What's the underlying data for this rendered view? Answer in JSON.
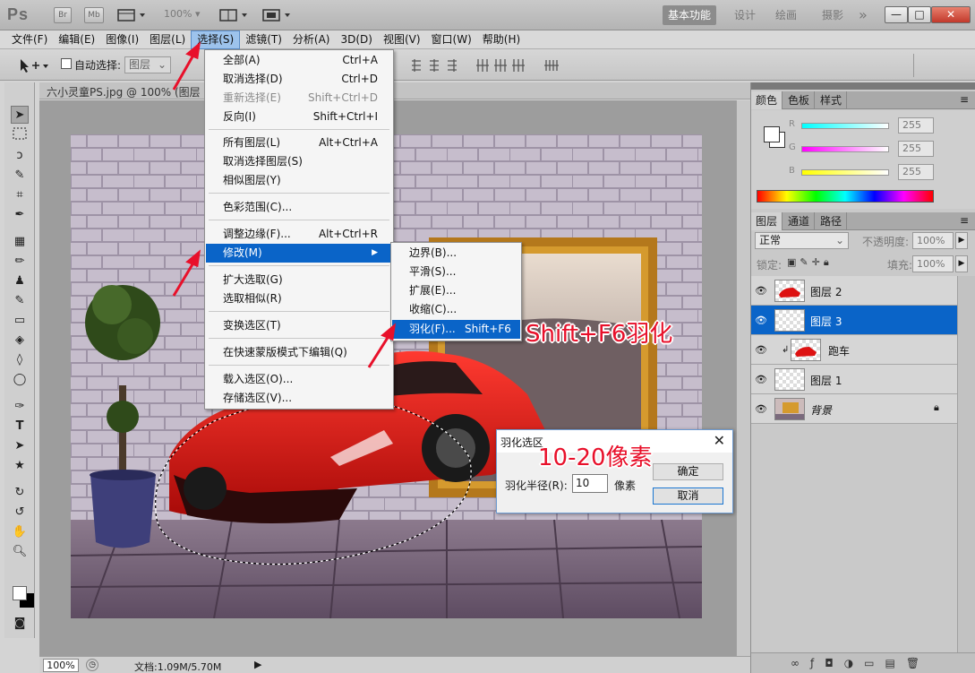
{
  "app": {
    "logo": "Ps",
    "buttons": [
      "Br",
      "Mb"
    ],
    "zoom_preset": "100%",
    "workspaces": [
      "基本功能",
      "设计",
      "绘画",
      "摄影"
    ],
    "more": "»",
    "window_controls": [
      "—",
      "□",
      "✕"
    ]
  },
  "menubar": [
    "文件(F)",
    "编辑(E)",
    "图像(I)",
    "图层(L)",
    "选择(S)",
    "滤镜(T)",
    "分析(A)",
    "3D(D)",
    "视图(V)",
    "窗口(W)",
    "帮助(H)"
  ],
  "options": {
    "auto_select_label": "自动选择:",
    "auto_select_value": "图层"
  },
  "document": {
    "tab_title": "六小灵童PS.jpg @ 100% (图层 3",
    "zoom": "100%",
    "doc_info": "文档:1.09M/5.70M"
  },
  "select_menu": [
    {
      "label": "全部(A)",
      "shortcut": "Ctrl+A",
      "state": "normal"
    },
    {
      "label": "取消选择(D)",
      "shortcut": "Ctrl+D",
      "state": "normal"
    },
    {
      "label": "重新选择(E)",
      "shortcut": "Shift+Ctrl+D",
      "state": "disabled"
    },
    {
      "label": "反向(I)",
      "shortcut": "Shift+Ctrl+I",
      "state": "normal"
    },
    {
      "label": "所有图层(L)",
      "shortcut": "Alt+Ctrl+A",
      "state": "normal"
    },
    {
      "label": "取消选择图层(S)",
      "shortcut": "",
      "state": "normal"
    },
    {
      "label": "相似图层(Y)",
      "shortcut": "",
      "state": "normal"
    },
    {
      "label": "色彩范围(C)...",
      "shortcut": "",
      "state": "normal"
    },
    {
      "label": "调整边缘(F)...",
      "shortcut": "Alt+Ctrl+R",
      "state": "normal"
    },
    {
      "label": "修改(M)",
      "shortcut": "",
      "state": "highlighted",
      "submenu": true
    },
    {
      "label": "扩大选取(G)",
      "shortcut": "",
      "state": "normal"
    },
    {
      "label": "选取相似(R)",
      "shortcut": "",
      "state": "normal"
    },
    {
      "label": "变换选区(T)",
      "shortcut": "",
      "state": "normal"
    },
    {
      "label": "在快速蒙版模式下编辑(Q)",
      "shortcut": "",
      "state": "normal"
    },
    {
      "label": "载入选区(O)...",
      "shortcut": "",
      "state": "normal"
    },
    {
      "label": "存储选区(V)...",
      "shortcut": "",
      "state": "normal"
    }
  ],
  "modify_submenu": [
    {
      "label": "边界(B)...",
      "shortcut": "",
      "state": "normal"
    },
    {
      "label": "平滑(S)...",
      "shortcut": "",
      "state": "normal"
    },
    {
      "label": "扩展(E)...",
      "shortcut": "",
      "state": "normal"
    },
    {
      "label": "收缩(C)...",
      "shortcut": "",
      "state": "normal"
    },
    {
      "label": "羽化(F)...",
      "shortcut": "Shift+F6",
      "state": "highlighted"
    }
  ],
  "annotations": {
    "shortcut_note": "Shift+F6羽化",
    "pixels_note": "10-20像素"
  },
  "feather_dialog": {
    "title": "羽化选区",
    "radius_label": "羽化半径(R):",
    "radius_value": "10",
    "unit": "像素",
    "ok": "确定",
    "cancel": "取消"
  },
  "color_panel": {
    "tabs": [
      "颜色",
      "色板",
      "样式"
    ],
    "channels": [
      {
        "label": "R",
        "value": "255",
        "gradient": [
          "#ffffff",
          "#00ffff"
        ]
      },
      {
        "label": "G",
        "value": "255",
        "gradient": [
          "#ffffff",
          "#ff00ff"
        ]
      },
      {
        "label": "B",
        "value": "255",
        "gradient": [
          "#ffffff",
          "#ffff00"
        ]
      }
    ]
  },
  "layers_panel": {
    "tabs": [
      "图层",
      "通道",
      "路径"
    ],
    "blend_mode": "正常",
    "opacity_label": "不透明度:",
    "opacity_value": "100%",
    "lock_label": "锁定:",
    "fill_label": "填充:",
    "fill_value": "100%",
    "layers": [
      {
        "name": "图层 2",
        "selected": false,
        "icon": "car-thumbnail"
      },
      {
        "name": "图层 3",
        "selected": true,
        "icon": "transparent-thumbnail"
      },
      {
        "name": "跑车",
        "selected": false,
        "icon": "car-thumbnail"
      },
      {
        "name": "图层 1",
        "selected": false,
        "icon": "transparent-thumbnail"
      },
      {
        "name": "背景",
        "selected": false,
        "icon": "room-thumbnail"
      }
    ]
  },
  "colors": {
    "accent": "#0a64c8",
    "annotation": "#e8102a"
  }
}
